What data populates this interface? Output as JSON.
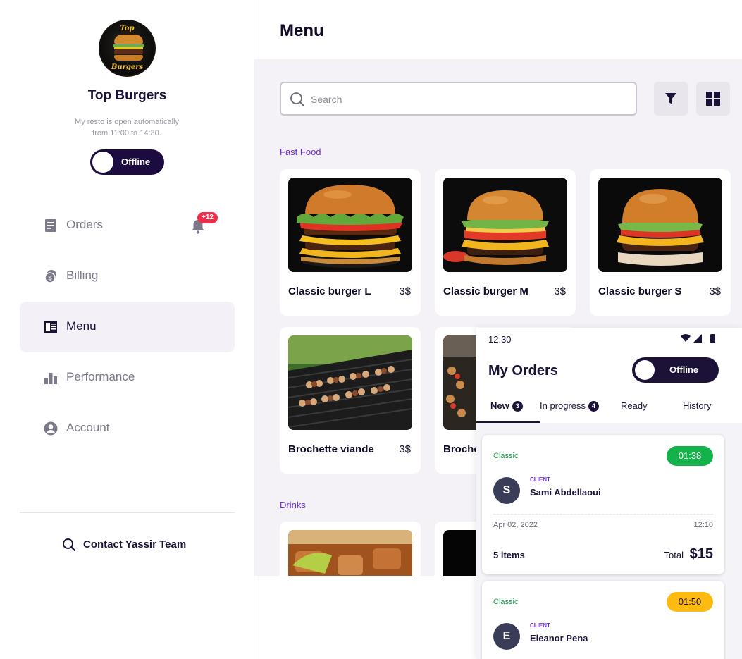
{
  "sidebar": {
    "logo": {
      "text_top": "Top",
      "text_bottom": "Burgers"
    },
    "brand_name": "Top Burgers",
    "open_hours_line1": "My resto is open automatically",
    "open_hours_line2": "from 11:00 to 14:30.",
    "status_toggle": "Offline",
    "nav": [
      {
        "label": "Orders",
        "icon": "document-icon",
        "active": false
      },
      {
        "label": "Billing",
        "icon": "coins-icon",
        "active": false
      },
      {
        "label": "Menu",
        "icon": "book-icon",
        "active": true
      },
      {
        "label": "Performance",
        "icon": "bar-chart-icon",
        "active": false
      },
      {
        "label": "Account",
        "icon": "user-circle-icon",
        "active": false
      }
    ],
    "orders_notification_badge": "+12",
    "contact_label": "Contact Yassir Team"
  },
  "main": {
    "title": "Menu",
    "search_placeholder": "Search",
    "sections": {
      "fast_food": "Fast Food",
      "drinks": "Drinks"
    },
    "fast_food_items": [
      {
        "name": "Classic burger L",
        "price": "3$"
      },
      {
        "name": "Classic burger M",
        "price": "3$"
      },
      {
        "name": "Classic burger S",
        "price": "3$"
      },
      {
        "name": "Brochette viande",
        "price": "3$"
      },
      {
        "name": "Broche",
        "price": ""
      }
    ]
  },
  "phone": {
    "time": "12:30",
    "title": "My Orders",
    "toggle_label": "Offline",
    "tabs": [
      {
        "label": "New",
        "badge": "3"
      },
      {
        "label": "In progress",
        "badge": "4"
      },
      {
        "label": "Ready",
        "badge": ""
      },
      {
        "label": "History",
        "badge": ""
      }
    ],
    "orders": [
      {
        "type": "Classic",
        "timer": "01:38",
        "client_label": "CLIENT",
        "initial": "S",
        "client_name": "Sami Abdellaoui",
        "date": "Apr 02, 2022",
        "time": "12:10",
        "items": "5 items",
        "total_label": "Total",
        "total": "$15"
      },
      {
        "type": "Classic",
        "timer": "01:50",
        "client_label": "CLIENT",
        "initial": "E",
        "client_name": "Eleanor Pena"
      }
    ]
  },
  "colors": {
    "primary_dark": "#1c0b3e",
    "accent_purple": "#6f2bd1",
    "notification_red": "#ec2f4b",
    "timer_green": "#13b24b",
    "timer_yellow": "#fdbb12"
  }
}
